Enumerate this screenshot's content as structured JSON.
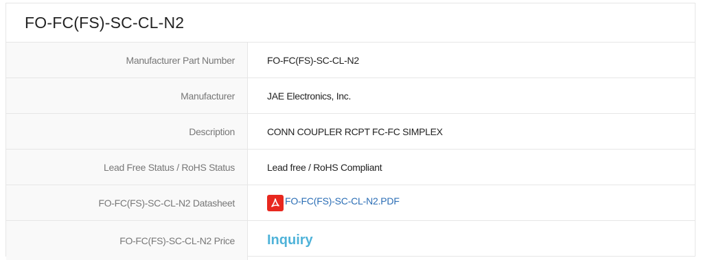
{
  "title": "FO-FC(FS)-SC-CL-N2",
  "rows": [
    {
      "label": "Manufacturer Part Number",
      "value": "FO-FC(FS)-SC-CL-N2"
    },
    {
      "label": "Manufacturer",
      "value": "JAE Electronics, Inc."
    },
    {
      "label": "Description",
      "value": "CONN COUPLER RCPT FC-FC SIMPLEX"
    },
    {
      "label": "Lead Free Status / RoHS Status",
      "value": "Lead free / RoHS Compliant"
    },
    {
      "label": "FO-FC(FS)-SC-CL-N2 Datasheet",
      "value": "FO-FC(FS)-SC-CL-N2.PDF",
      "icon": "pdf-icon"
    },
    {
      "label": "FO-FC(FS)-SC-CL-N2 Price",
      "value": "Inquiry"
    }
  ],
  "colors": {
    "link": "#2a6db5",
    "inquiry": "#4fb3d9",
    "pdf_icon": "#e8281f"
  }
}
